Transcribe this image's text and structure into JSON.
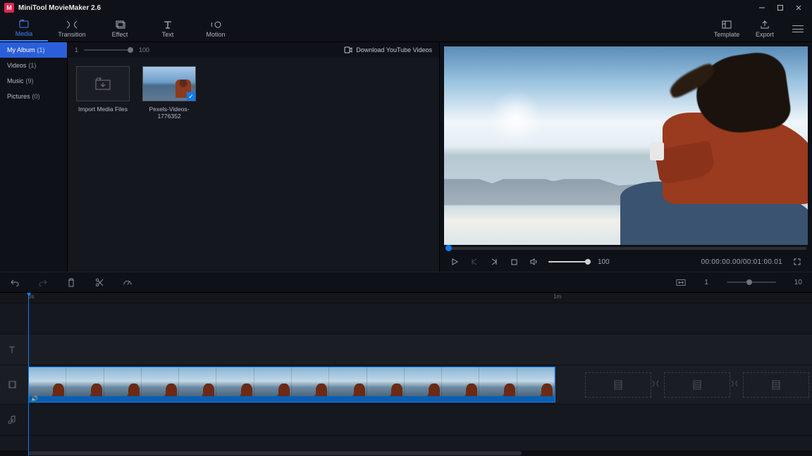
{
  "titlebar": {
    "app_name": "MiniTool MovieMaker 2.6"
  },
  "toolbar": {
    "media": "Media",
    "transition": "Transition",
    "effect": "Effect",
    "text": "Text",
    "motion": "Motion",
    "template": "Template",
    "export": "Export"
  },
  "sidebar": {
    "my_album": {
      "label": "My Album",
      "count": "(1)"
    },
    "videos": {
      "label": "Videos",
      "count": "(1)"
    },
    "music": {
      "label": "Music",
      "count": "(9)"
    },
    "pictures": {
      "label": "Pictures",
      "count": "(0)"
    }
  },
  "media_head": {
    "zoom_min": "1",
    "zoom_max": "100",
    "download_label": "Download YouTube Videos"
  },
  "media_items": {
    "import_label": "Import Media Files",
    "clip1_label": "Pexels-Videos-1776352"
  },
  "preview": {
    "volume_value": "100",
    "time_current": "00:00:00.00",
    "time_total": "00:01:00.01"
  },
  "timeline_tools": {
    "zoom_min": "1",
    "zoom_max": "10"
  },
  "ruler": {
    "zero": "0s",
    "one_min": "1m"
  }
}
